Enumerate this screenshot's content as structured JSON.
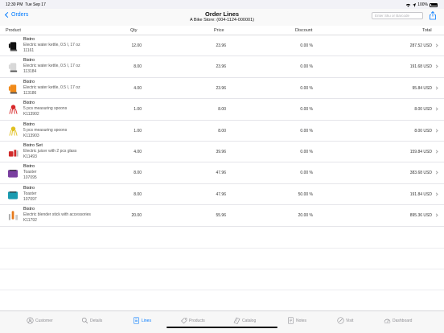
{
  "status": {
    "time": "12:30 PM",
    "date": "Tue Sep 17",
    "battery": "100%"
  },
  "nav": {
    "back_label": "Orders",
    "title": "Order Lines",
    "subtitle": "A Bike Store: (004-1124-000001)",
    "search_placeholder": "Enter Sku or Barcode"
  },
  "columns": {
    "product": "Product",
    "qty": "Qty",
    "price": "Price",
    "discount": "Discount",
    "total": "Total"
  },
  "lines": [
    {
      "name": "Bistro",
      "desc": "Electric water kettle, 0.5 l, 17 oz",
      "code": "11161",
      "qty": "12.00",
      "price": "23.96",
      "discount": "0.00 %",
      "total": "287.52 USD",
      "icon": "black-kettle-icon",
      "color": "#111111"
    },
    {
      "name": "Bistro",
      "desc": "Electric water kettle, 0.5 l, 17 oz",
      "code": "113184",
      "qty": "8.00",
      "price": "23.96",
      "discount": "0.00 %",
      "total": "191.68 USD",
      "icon": "white-kettle-icon",
      "color": "#d8d8d8"
    },
    {
      "name": "Bistro",
      "desc": "Electric water kettle, 0.5 l, 17 oz",
      "code": "113186",
      "qty": "4.00",
      "price": "23.96",
      "discount": "0.00 %",
      "total": "95.84 USD",
      "icon": "orange-kettle-icon",
      "color": "#f08a1a"
    },
    {
      "name": "Bistro",
      "desc": "5 pcs measuring spoons",
      "code": "K113902",
      "qty": "1.00",
      "price": "8.00",
      "discount": "0.00 %",
      "total": "8.00 USD",
      "icon": "red-spoons-icon",
      "color": "#d8282a"
    },
    {
      "name": "Bistro",
      "desc": "5 pcs measuring spoons",
      "code": "K113903",
      "qty": "1.00",
      "price": "8.00",
      "discount": "0.00 %",
      "total": "8.00 USD",
      "icon": "yellow-spoons-icon",
      "color": "#e0c020"
    },
    {
      "name": "Bistro Set",
      "desc": "Electric juicer with 2 pcs glass",
      "code": "K11493",
      "qty": "4.00",
      "price": "39.96",
      "discount": "0.00 %",
      "total": "159.84 USD",
      "icon": "red-juicer-icon",
      "color": "#d02a2a"
    },
    {
      "name": "Bistro",
      "desc": "Toaster",
      "code": "107095",
      "qty": "8.00",
      "price": "47.96",
      "discount": "0.00 %",
      "total": "383.68 USD",
      "icon": "purple-toaster-icon",
      "color": "#7a3fa0"
    },
    {
      "name": "Bistro",
      "desc": "Toaster",
      "code": "107097",
      "qty": "8.00",
      "price": "47.96",
      "discount": "50.00 %",
      "total": "191.84 USD",
      "icon": "teal-toaster-icon",
      "color": "#1a9bb0"
    },
    {
      "name": "Bistro",
      "desc": "Electric blender stick with accessories",
      "code": "K11792",
      "qty": "20.00",
      "price": "55.96",
      "discount": "20.00 %",
      "total": "895.36 USD",
      "icon": "blender-icon",
      "color": "#e67a1c"
    }
  ],
  "tabs": [
    {
      "label": "Customer",
      "icon": "customer-icon"
    },
    {
      "label": "Details",
      "icon": "details-icon"
    },
    {
      "label": "Lines",
      "icon": "lines-icon",
      "active": true
    },
    {
      "label": "Products",
      "icon": "products-icon"
    },
    {
      "label": "Catalog",
      "icon": "catalog-icon"
    },
    {
      "label": "Notes",
      "icon": "notes-icon"
    },
    {
      "label": "Visit",
      "icon": "visit-icon"
    },
    {
      "label": "Dashboard",
      "icon": "dashboard-icon"
    }
  ],
  "accent": "#007aff"
}
